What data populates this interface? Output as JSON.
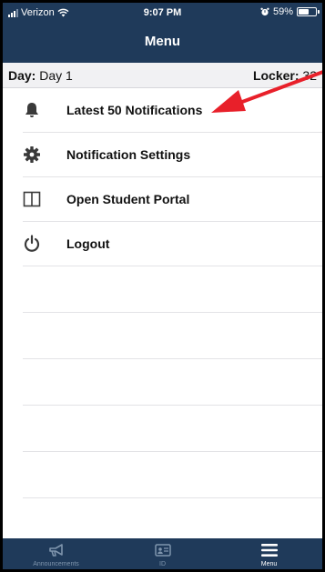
{
  "status_bar": {
    "carrier": "Verizon",
    "time": "9:07 PM",
    "battery_text": "59%",
    "battery_level": 0.59
  },
  "nav": {
    "title": "Menu"
  },
  "info": {
    "day_label": "Day:",
    "day_value": "Day 1",
    "locker_label": "Locker:",
    "locker_value": "32"
  },
  "menu": {
    "items": [
      {
        "label": "Latest 50 Notifications",
        "icon": "bell-icon"
      },
      {
        "label": "Notification Settings",
        "icon": "gear-icon"
      },
      {
        "label": "Open Student Portal",
        "icon": "portal-panel-icon"
      },
      {
        "label": "Logout",
        "icon": "power-icon"
      }
    ]
  },
  "tabs": [
    {
      "label": "Announcements",
      "icon": "megaphone-icon",
      "active": false
    },
    {
      "label": "ID",
      "icon": "id-card-icon",
      "active": false
    },
    {
      "label": "Menu",
      "icon": "hamburger-menu-icon",
      "active": true
    }
  ],
  "colors": {
    "bar_background": "#1f3a5a",
    "arrow": "#e8202a",
    "tab_inactive": "#7f95ad",
    "tab_active": "#ffffff"
  }
}
